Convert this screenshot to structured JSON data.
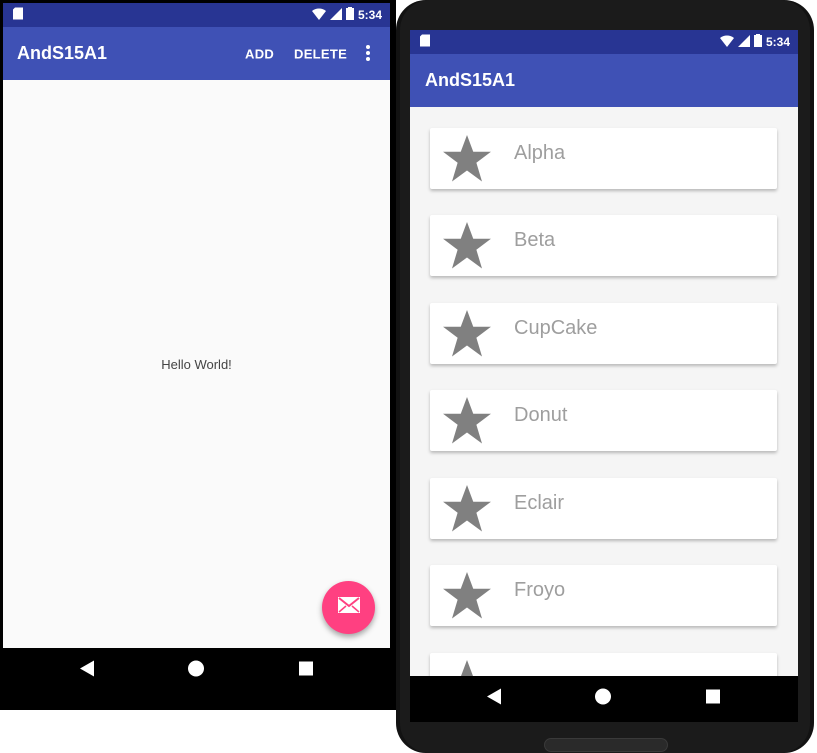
{
  "left_phone": {
    "status_time": "5:34",
    "app_title": "AndS15A1",
    "actions": [
      "ADD",
      "DELETE"
    ],
    "overflow_icon": "more-vert-icon",
    "body_text": "Hello World!",
    "fab_icon": "mail-icon",
    "fab_color": "#ff4081"
  },
  "right_phone": {
    "status_time": "5:34",
    "app_title": "AndS15A1",
    "list_icon": "star-icon",
    "items": [
      "Alpha",
      "Beta",
      "CupCake",
      "Donut",
      "Eclair",
      "Froyo"
    ]
  },
  "colors": {
    "primary": "#3f51b5",
    "primary_dark": "#283593",
    "accent": "#ff4081",
    "star": "#808080"
  }
}
